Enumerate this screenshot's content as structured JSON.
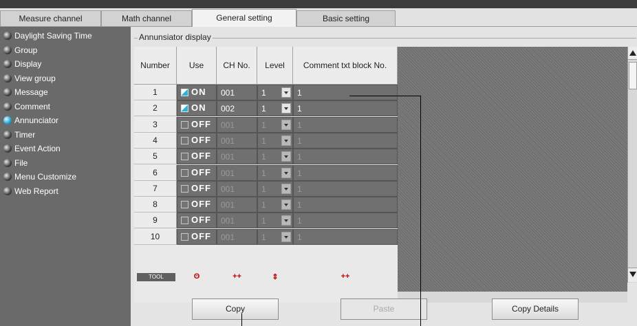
{
  "tabs": [
    {
      "label": "Measure channel"
    },
    {
      "label": "Math channel"
    },
    {
      "label": "General setting",
      "active": true
    },
    {
      "label": "Basic setting"
    }
  ],
  "sidebar": {
    "items": [
      {
        "label": "Daylight Saving Time"
      },
      {
        "label": "Group"
      },
      {
        "label": "Display"
      },
      {
        "label": "View group"
      },
      {
        "label": "Message"
      },
      {
        "label": "Comment"
      },
      {
        "label": "Annunciator",
        "active": true
      },
      {
        "label": "Timer"
      },
      {
        "label": "Event Action"
      },
      {
        "label": "File"
      },
      {
        "label": "Menu Customize"
      },
      {
        "label": "Web Report"
      }
    ]
  },
  "section": {
    "title": "Annunsiator display"
  },
  "table": {
    "headers": {
      "number": "Number",
      "use": "Use",
      "ch_no": "CH No.",
      "level": "Level",
      "comment": "Comment txt block No."
    },
    "rows": [
      {
        "number": "1",
        "use": "ON",
        "ch": "001",
        "level": "1",
        "comment": "1"
      },
      {
        "number": "2",
        "use": "ON",
        "ch": "002",
        "level": "1",
        "comment": "1"
      },
      {
        "number": "3",
        "use": "OFF",
        "ch": "001",
        "level": "1",
        "comment": "1"
      },
      {
        "number": "4",
        "use": "OFF",
        "ch": "001",
        "level": "1",
        "comment": "1"
      },
      {
        "number": "5",
        "use": "OFF",
        "ch": "001",
        "level": "1",
        "comment": "1"
      },
      {
        "number": "6",
        "use": "OFF",
        "ch": "001",
        "level": "1",
        "comment": "1"
      },
      {
        "number": "7",
        "use": "OFF",
        "ch": "001",
        "level": "1",
        "comment": "1"
      },
      {
        "number": "8",
        "use": "OFF",
        "ch": "001",
        "level": "1",
        "comment": "1"
      },
      {
        "number": "9",
        "use": "OFF",
        "ch": "001",
        "level": "1",
        "comment": "1"
      },
      {
        "number": "10",
        "use": "OFF",
        "ch": "001",
        "level": "1",
        "comment": "1"
      }
    ],
    "tool": {
      "label": "TOOL",
      "use_icon": "ʘ",
      "ch_icon": "++",
      "level_icon": "⇕",
      "comment_icon": "++"
    }
  },
  "buttons": {
    "copy": "Copy",
    "paste": "Paste",
    "copy_details": "Copy Details"
  }
}
